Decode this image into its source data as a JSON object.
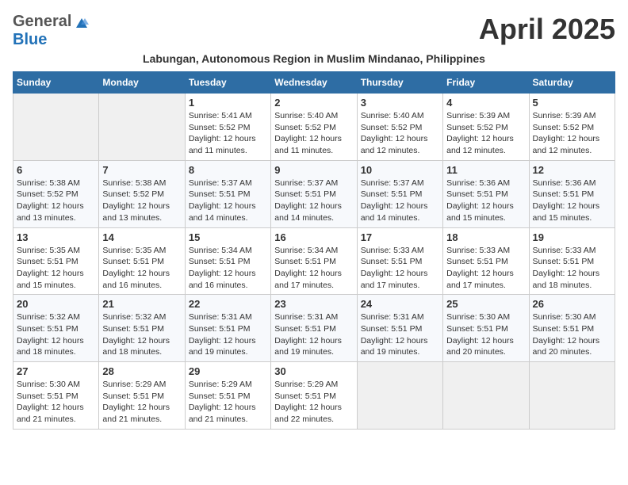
{
  "header": {
    "logo_general": "General",
    "logo_blue": "Blue",
    "month_title": "April 2025",
    "subtitle": "Labungan, Autonomous Region in Muslim Mindanao, Philippines"
  },
  "weekdays": [
    "Sunday",
    "Monday",
    "Tuesday",
    "Wednesday",
    "Thursday",
    "Friday",
    "Saturday"
  ],
  "weeks": [
    [
      {
        "day": "",
        "sunrise": "",
        "sunset": "",
        "daylight": ""
      },
      {
        "day": "",
        "sunrise": "",
        "sunset": "",
        "daylight": ""
      },
      {
        "day": "1",
        "sunrise": "Sunrise: 5:41 AM",
        "sunset": "Sunset: 5:52 PM",
        "daylight": "Daylight: 12 hours and 11 minutes."
      },
      {
        "day": "2",
        "sunrise": "Sunrise: 5:40 AM",
        "sunset": "Sunset: 5:52 PM",
        "daylight": "Daylight: 12 hours and 11 minutes."
      },
      {
        "day": "3",
        "sunrise": "Sunrise: 5:40 AM",
        "sunset": "Sunset: 5:52 PM",
        "daylight": "Daylight: 12 hours and 12 minutes."
      },
      {
        "day": "4",
        "sunrise": "Sunrise: 5:39 AM",
        "sunset": "Sunset: 5:52 PM",
        "daylight": "Daylight: 12 hours and 12 minutes."
      },
      {
        "day": "5",
        "sunrise": "Sunrise: 5:39 AM",
        "sunset": "Sunset: 5:52 PM",
        "daylight": "Daylight: 12 hours and 12 minutes."
      }
    ],
    [
      {
        "day": "6",
        "sunrise": "Sunrise: 5:38 AM",
        "sunset": "Sunset: 5:52 PM",
        "daylight": "Daylight: 12 hours and 13 minutes."
      },
      {
        "day": "7",
        "sunrise": "Sunrise: 5:38 AM",
        "sunset": "Sunset: 5:52 PM",
        "daylight": "Daylight: 12 hours and 13 minutes."
      },
      {
        "day": "8",
        "sunrise": "Sunrise: 5:37 AM",
        "sunset": "Sunset: 5:51 PM",
        "daylight": "Daylight: 12 hours and 14 minutes."
      },
      {
        "day": "9",
        "sunrise": "Sunrise: 5:37 AM",
        "sunset": "Sunset: 5:51 PM",
        "daylight": "Daylight: 12 hours and 14 minutes."
      },
      {
        "day": "10",
        "sunrise": "Sunrise: 5:37 AM",
        "sunset": "Sunset: 5:51 PM",
        "daylight": "Daylight: 12 hours and 14 minutes."
      },
      {
        "day": "11",
        "sunrise": "Sunrise: 5:36 AM",
        "sunset": "Sunset: 5:51 PM",
        "daylight": "Daylight: 12 hours and 15 minutes."
      },
      {
        "day": "12",
        "sunrise": "Sunrise: 5:36 AM",
        "sunset": "Sunset: 5:51 PM",
        "daylight": "Daylight: 12 hours and 15 minutes."
      }
    ],
    [
      {
        "day": "13",
        "sunrise": "Sunrise: 5:35 AM",
        "sunset": "Sunset: 5:51 PM",
        "daylight": "Daylight: 12 hours and 15 minutes."
      },
      {
        "day": "14",
        "sunrise": "Sunrise: 5:35 AM",
        "sunset": "Sunset: 5:51 PM",
        "daylight": "Daylight: 12 hours and 16 minutes."
      },
      {
        "day": "15",
        "sunrise": "Sunrise: 5:34 AM",
        "sunset": "Sunset: 5:51 PM",
        "daylight": "Daylight: 12 hours and 16 minutes."
      },
      {
        "day": "16",
        "sunrise": "Sunrise: 5:34 AM",
        "sunset": "Sunset: 5:51 PM",
        "daylight": "Daylight: 12 hours and 17 minutes."
      },
      {
        "day": "17",
        "sunrise": "Sunrise: 5:33 AM",
        "sunset": "Sunset: 5:51 PM",
        "daylight": "Daylight: 12 hours and 17 minutes."
      },
      {
        "day": "18",
        "sunrise": "Sunrise: 5:33 AM",
        "sunset": "Sunset: 5:51 PM",
        "daylight": "Daylight: 12 hours and 17 minutes."
      },
      {
        "day": "19",
        "sunrise": "Sunrise: 5:33 AM",
        "sunset": "Sunset: 5:51 PM",
        "daylight": "Daylight: 12 hours and 18 minutes."
      }
    ],
    [
      {
        "day": "20",
        "sunrise": "Sunrise: 5:32 AM",
        "sunset": "Sunset: 5:51 PM",
        "daylight": "Daylight: 12 hours and 18 minutes."
      },
      {
        "day": "21",
        "sunrise": "Sunrise: 5:32 AM",
        "sunset": "Sunset: 5:51 PM",
        "daylight": "Daylight: 12 hours and 18 minutes."
      },
      {
        "day": "22",
        "sunrise": "Sunrise: 5:31 AM",
        "sunset": "Sunset: 5:51 PM",
        "daylight": "Daylight: 12 hours and 19 minutes."
      },
      {
        "day": "23",
        "sunrise": "Sunrise: 5:31 AM",
        "sunset": "Sunset: 5:51 PM",
        "daylight": "Daylight: 12 hours and 19 minutes."
      },
      {
        "day": "24",
        "sunrise": "Sunrise: 5:31 AM",
        "sunset": "Sunset: 5:51 PM",
        "daylight": "Daylight: 12 hours and 19 minutes."
      },
      {
        "day": "25",
        "sunrise": "Sunrise: 5:30 AM",
        "sunset": "Sunset: 5:51 PM",
        "daylight": "Daylight: 12 hours and 20 minutes."
      },
      {
        "day": "26",
        "sunrise": "Sunrise: 5:30 AM",
        "sunset": "Sunset: 5:51 PM",
        "daylight": "Daylight: 12 hours and 20 minutes."
      }
    ],
    [
      {
        "day": "27",
        "sunrise": "Sunrise: 5:30 AM",
        "sunset": "Sunset: 5:51 PM",
        "daylight": "Daylight: 12 hours and 21 minutes."
      },
      {
        "day": "28",
        "sunrise": "Sunrise: 5:29 AM",
        "sunset": "Sunset: 5:51 PM",
        "daylight": "Daylight: 12 hours and 21 minutes."
      },
      {
        "day": "29",
        "sunrise": "Sunrise: 5:29 AM",
        "sunset": "Sunset: 5:51 PM",
        "daylight": "Daylight: 12 hours and 21 minutes."
      },
      {
        "day": "30",
        "sunrise": "Sunrise: 5:29 AM",
        "sunset": "Sunset: 5:51 PM",
        "daylight": "Daylight: 12 hours and 22 minutes."
      },
      {
        "day": "",
        "sunrise": "",
        "sunset": "",
        "daylight": ""
      },
      {
        "day": "",
        "sunrise": "",
        "sunset": "",
        "daylight": ""
      },
      {
        "day": "",
        "sunrise": "",
        "sunset": "",
        "daylight": ""
      }
    ]
  ]
}
